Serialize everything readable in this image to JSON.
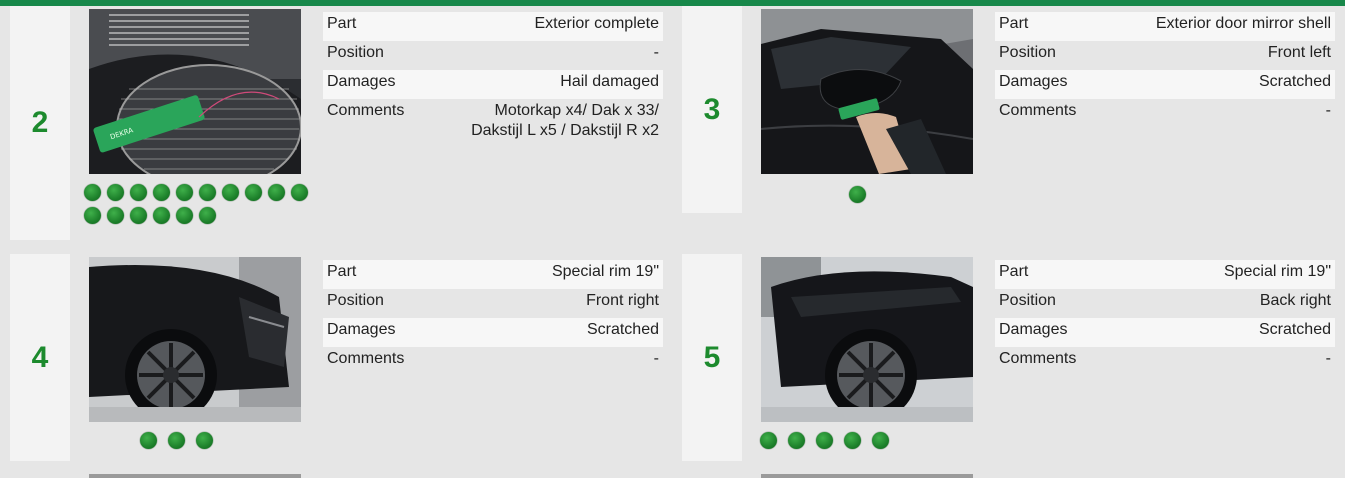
{
  "labels": {
    "part": "Part",
    "position": "Position",
    "damages": "Damages",
    "comments": "Comments"
  },
  "cards": [
    {
      "number": "2",
      "photo_icon": "car-roof-with-tag-photo",
      "part": "Exterior complete",
      "position": "-",
      "damages": "Hail damaged",
      "comments": "Motorkap x4/ Dak x 33/ Dakstijl L x5 / Dakstijl R x2",
      "dot_count": 16
    },
    {
      "number": "3",
      "photo_icon": "door-mirror-photo",
      "part": "Exterior door mirror shell",
      "position": "Front left",
      "damages": "Scratched",
      "comments": "-",
      "dot_count": 1
    },
    {
      "number": "4",
      "photo_icon": "front-wheel-photo",
      "part": "Special rim 19\"",
      "position": "Front right",
      "damages": "Scratched",
      "comments": "-",
      "dot_count": 3
    },
    {
      "number": "5",
      "photo_icon": "rear-wheel-photo",
      "part": "Special rim 19\"",
      "position": "Back right",
      "damages": "Scratched",
      "comments": "-",
      "dot_count": 5
    }
  ],
  "colors": {
    "accent": "#1c8a2d",
    "top_bar": "#17884a",
    "background": "#e6e6e6"
  }
}
